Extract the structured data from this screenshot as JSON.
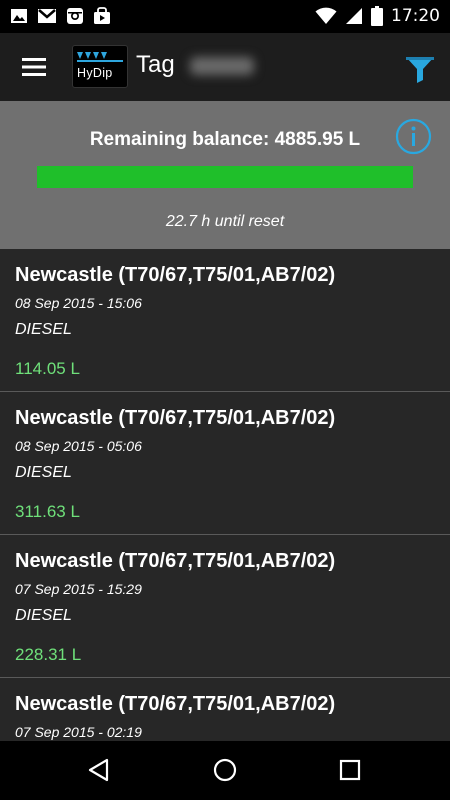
{
  "status_bar": {
    "time": "17:20",
    "left_icons": [
      "image-icon",
      "gmail-icon",
      "instagram-icon",
      "store-bag-icon"
    ],
    "right_icons": [
      "wifi-icon",
      "signal-icon",
      "battery-icon"
    ]
  },
  "app_bar": {
    "logo_text": "HyDip",
    "title": "Tag",
    "accent_color": "#29a8e0"
  },
  "balance": {
    "text": "Remaining balance: 4885.95 L",
    "progress_fraction": 1.0,
    "progress_color": "#1fbf2a",
    "reset_text": "22.7 h until reset"
  },
  "transactions": [
    {
      "site": "Newcastle (T70/67,T75/01,AB7/02)",
      "date": "08 Sep 2015 - 15:06",
      "fuel": "DIESEL",
      "amount": "114.05 L"
    },
    {
      "site": "Newcastle (T70/67,T75/01,AB7/02)",
      "date": "08 Sep 2015 - 05:06",
      "fuel": "DIESEL",
      "amount": "311.63 L"
    },
    {
      "site": "Newcastle (T70/67,T75/01,AB7/02)",
      "date": "07 Sep 2015 - 15:29",
      "fuel": "DIESEL",
      "amount": "228.31 L"
    },
    {
      "site": "Newcastle (T70/67,T75/01,AB7/02)",
      "date": "07 Sep 2015 - 02:19",
      "fuel": "",
      "amount": ""
    }
  ],
  "nav": [
    "back-icon",
    "home-icon",
    "recents-icon"
  ]
}
